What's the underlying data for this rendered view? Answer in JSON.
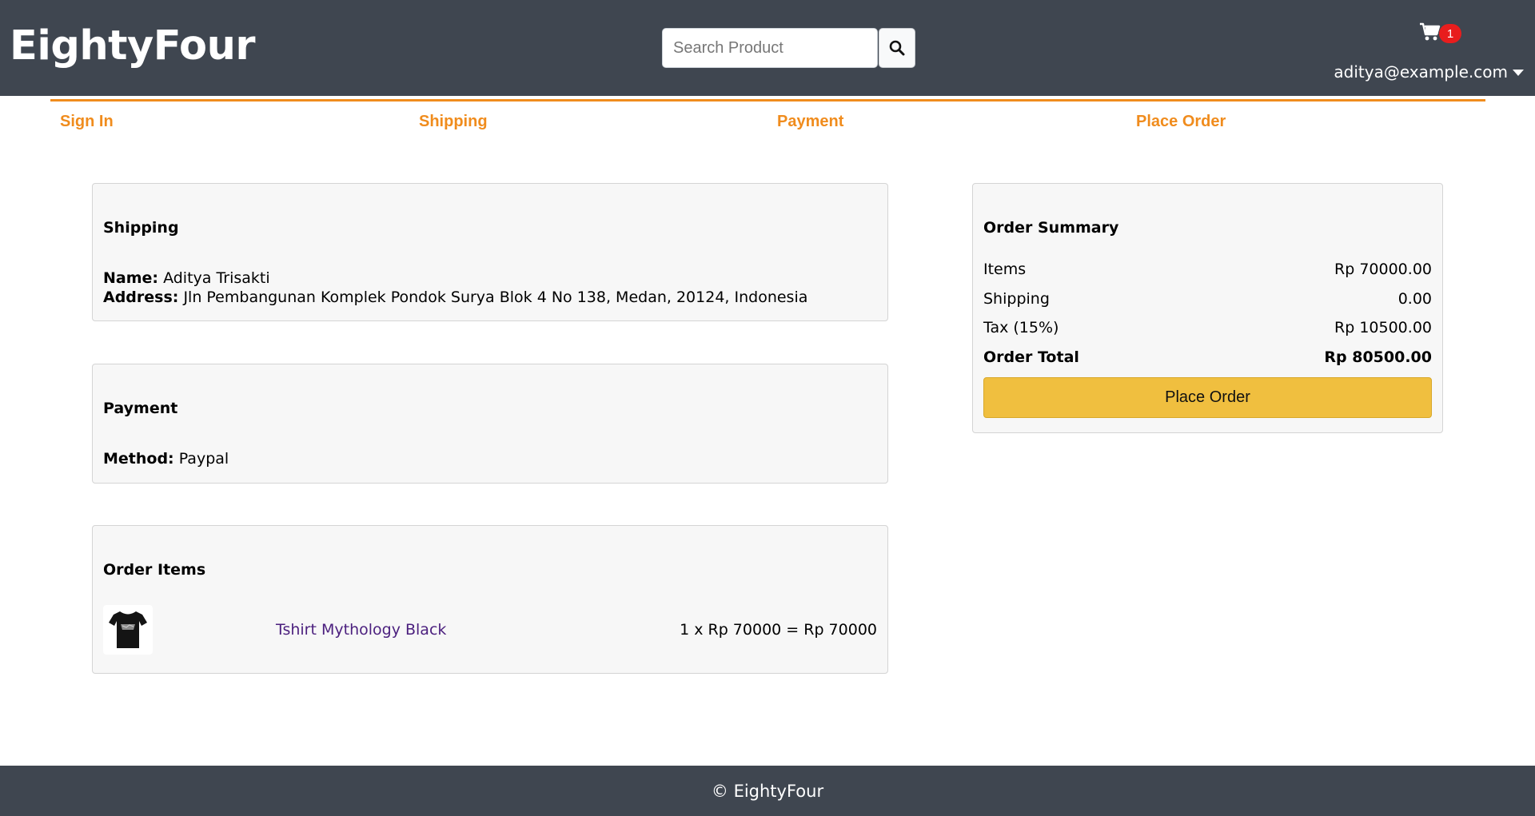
{
  "header": {
    "brand": "EightyFour",
    "search_placeholder": "Search Product",
    "cart_count": "1",
    "user_email": "aditya@example.com"
  },
  "steps": {
    "sign_in": "Sign In",
    "shipping": "Shipping",
    "payment": "Payment",
    "place_order": "Place Order"
  },
  "shipping": {
    "title": "Shipping",
    "name_label": "Name:",
    "name_value": "Aditya Trisakti",
    "address_label": "Address:",
    "address_value": "Jln Pembangunan Komplek Pondok Surya Blok 4 No 138, Medan, 20124, Indonesia"
  },
  "payment": {
    "title": "Payment",
    "method_label": "Method:",
    "method_value": "Paypal"
  },
  "order_items": {
    "title": "Order Items",
    "items": [
      {
        "name": "Tshirt Mythology Black",
        "price_line": "1 x Rp 70000 = Rp 70000"
      }
    ]
  },
  "summary": {
    "title": "Order Summary",
    "items_label": "Items",
    "items_value": "Rp 70000.00",
    "shipping_label": "Shipping",
    "shipping_value": "0.00",
    "tax_label": "Tax (15%)",
    "tax_value": "Rp 10500.00",
    "total_label": "Order Total",
    "total_value": "Rp 80500.00",
    "button_label": "Place Order"
  },
  "footer": {
    "text": "© EightyFour"
  },
  "colors": {
    "header_bg": "#3f4650",
    "accent_orange": "#f08c1d",
    "button_yellow": "#f0bf3f",
    "badge_red": "#e81d1d",
    "link_purple": "#4b1f7e"
  },
  "icons": [
    "search-icon",
    "cart-icon",
    "caret-down-icon",
    "tshirt-icon"
  ]
}
